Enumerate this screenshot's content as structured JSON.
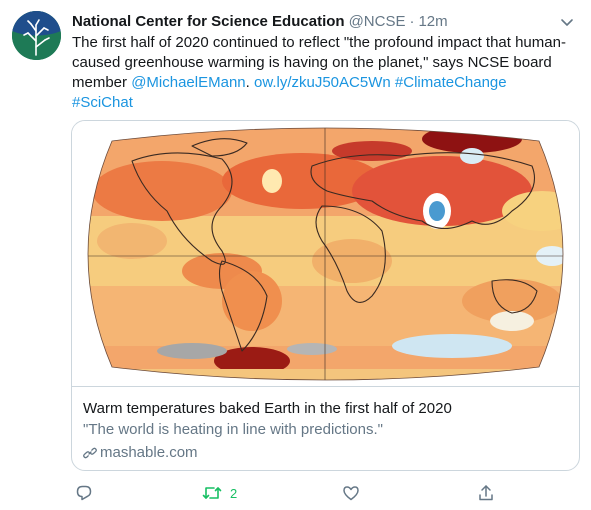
{
  "tweet": {
    "author_name": "National Center for Science Education",
    "handle": "@NCSE",
    "separator": "·",
    "time": "12m",
    "text_parts": {
      "line1": "The first half of 2020 continued to reflect \"the profound impact that human-caused greenhouse warming is having on the planet,\" says NCSE board member ",
      "mention": "@MichaelEMann",
      "space1": ". ",
      "url": "ow.ly/zkuJ50AC5Wn",
      "space2": " ",
      "hashtag1": "#ClimateChange",
      "hashtag2": "#SciChat"
    },
    "card": {
      "title": "Warm temperatures baked Earth in the first half of 2020",
      "description": "\"The world is heating in line with predictions.\"",
      "domain": "mashable.com"
    },
    "actions": {
      "retweet_count": "2"
    },
    "colors": {
      "link": "#1b95e0",
      "retweet_active": "#17bf63",
      "muted": "#657786"
    },
    "icons": [
      "ncse-logo",
      "chevron-down-icon",
      "reply-icon",
      "retweet-icon",
      "like-icon",
      "share-icon",
      "link-icon"
    ]
  }
}
